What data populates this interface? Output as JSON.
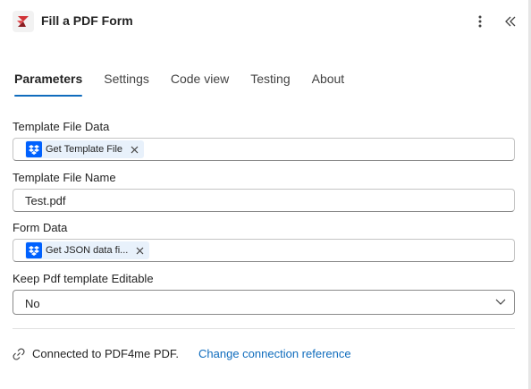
{
  "header": {
    "title": "Fill a PDF Form",
    "icons": {
      "app": "pdf4me-app-icon",
      "more": "more-vertical-icon",
      "collapse": "double-chevron-left-icon"
    }
  },
  "tabs": [
    {
      "label": "Parameters",
      "active": true
    },
    {
      "label": "Settings",
      "active": false
    },
    {
      "label": "Code view",
      "active": false
    },
    {
      "label": "Testing",
      "active": false
    },
    {
      "label": "About",
      "active": false
    }
  ],
  "fields": {
    "template_file_data": {
      "label": "Template File Data",
      "token": "Get Template File",
      "token_icon": "dropbox-icon"
    },
    "template_file_name": {
      "label": "Template File Name",
      "value": "Test.pdf"
    },
    "form_data": {
      "label": "Form Data",
      "token": "Get JSON data fi...",
      "token_icon": "dropbox-icon"
    },
    "keep_editable": {
      "label": "Keep Pdf template Editable",
      "value": "No"
    }
  },
  "connection": {
    "icon": "link-icon",
    "text": "Connected to PDF4me PDF.",
    "change_link": "Change connection reference"
  },
  "colors": {
    "accent": "#0f6cbd",
    "dropbox": "#0061fe",
    "token_bg": "#e8f1fb"
  }
}
